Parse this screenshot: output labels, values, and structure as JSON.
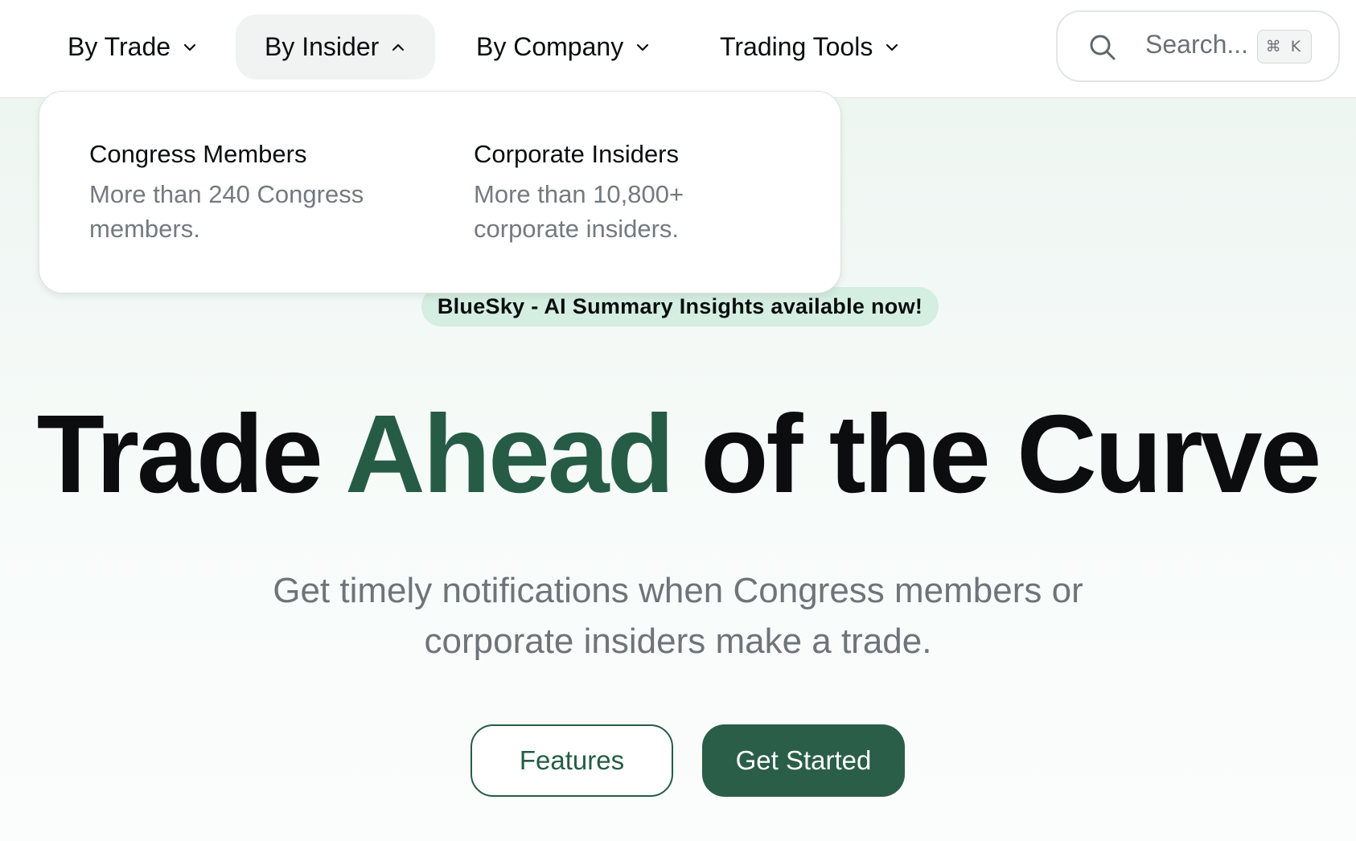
{
  "nav": {
    "items": [
      {
        "label": "By Trade",
        "icon": "chevron-down-icon"
      },
      {
        "label": "By Insider",
        "icon": "chevron-up-icon",
        "active": true
      },
      {
        "label": "By Company",
        "icon": "chevron-down-icon"
      },
      {
        "label": "Trading Tools",
        "icon": "chevron-down-icon"
      }
    ],
    "search": {
      "placeholder": "Search...",
      "shortcut": "⌘ K",
      "icon": "search-icon"
    }
  },
  "dropdown": {
    "items": [
      {
        "title": "Congress Members",
        "description": "More than 240 Congress members."
      },
      {
        "title": "Corporate Insiders",
        "description": "More than 10,800+ corporate insiders."
      }
    ]
  },
  "hero": {
    "announcement": "BlueSky - AI Summary Insights available now!",
    "title_part1": "Trade",
    "title_accent": "Ahead",
    "title_part2": "of the Curve",
    "subtitle": "Get timely notifications when Congress members or corporate insiders make a trade.",
    "buttons": {
      "features": "Features",
      "get_started": "Get Started"
    }
  },
  "colors": {
    "accent": "#265c46",
    "announcement_bg": "#d4eee2",
    "text": "#0b0d0e",
    "muted": "#6e7479"
  }
}
